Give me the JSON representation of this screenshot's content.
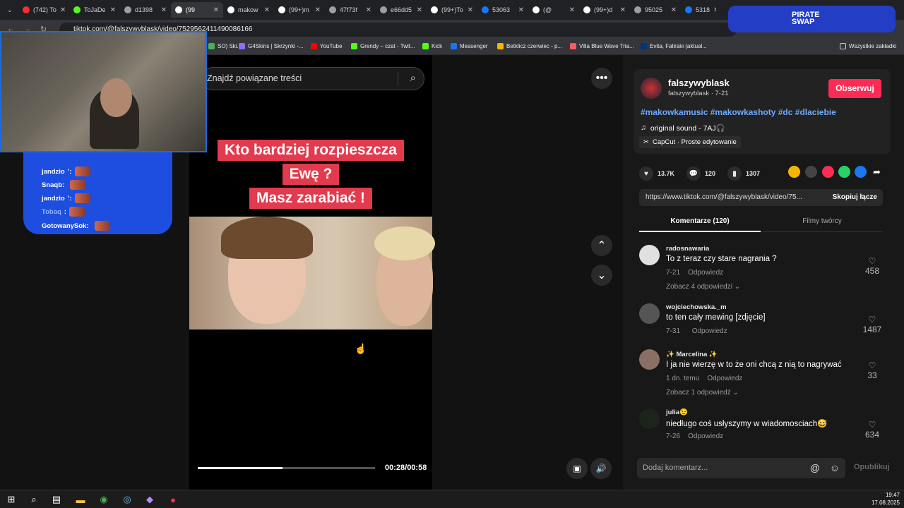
{
  "browser": {
    "tabs": [
      {
        "label": "(742) To",
        "color": "#ff2d2d"
      },
      {
        "label": "ToJaDe",
        "color": "#53fc18"
      },
      {
        "label": "d1398",
        "color": "#9aa0a6"
      },
      {
        "label": "(99",
        "color": "#ffffff",
        "active": true
      },
      {
        "label": "makow",
        "color": "#ffffff"
      },
      {
        "label": "(99+)m",
        "color": "#ffffff"
      },
      {
        "label": "47f73f",
        "color": "#9aa0a6"
      },
      {
        "label": "e66dd5",
        "color": "#9aa0a6"
      },
      {
        "label": "(99+)To",
        "color": "#ffffff"
      },
      {
        "label": "53063",
        "color": "#1877f2"
      },
      {
        "label": "(@",
        "color": "#ffffff"
      },
      {
        "label": "(99+)d",
        "color": "#ffffff"
      },
      {
        "label": "95025",
        "color": "#9aa0a6"
      },
      {
        "label": "5318",
        "color": "#1877f2"
      }
    ],
    "url": "tiktok.com/@falszywyblask/video/7529562411490086166",
    "bookmarks": [
      {
        "label": "SO) Ski...",
        "color": "#4caf50"
      },
      {
        "label": "G4Skins | Skrzynki -...",
        "color": "#8e6cff"
      },
      {
        "label": "YouTube",
        "color": "#ff0000"
      },
      {
        "label": "Grendy – czat - Twit...",
        "color": "#53fc18"
      },
      {
        "label": "Kick",
        "color": "#53fc18"
      },
      {
        "label": "Messenger",
        "color": "#1877f2"
      },
      {
        "label": "Betklicz czerwiec - p...",
        "color": "#f4b400"
      },
      {
        "label": "Villa Blue Wave Tria...",
        "color": "#ff5a5f"
      },
      {
        "label": "Evita, Faliraki (aktual...",
        "color": "#003580"
      }
    ],
    "all_bookmarks": "Wszystkie zakładki"
  },
  "overlay": {
    "pirate_swap": "PIRATE SWAP",
    "chat": [
      {
        "name": "jandzio",
        "suffix": "’:"
      },
      {
        "name": "Snaqb:",
        "suffix": ""
      },
      {
        "name": "jandzio",
        "suffix": "’:"
      },
      {
        "name": "Tobaq",
        "suffix": ":"
      },
      {
        "name": "GotowanySok:",
        "suffix": ""
      }
    ]
  },
  "video": {
    "search_placeholder": "Znajdź powiązane treści",
    "caption_lines": [
      "Kto bardziej rozpieszcza",
      "Ewę ?",
      "Masz zarabiać !"
    ],
    "time": "00:28/00:58",
    "progress": 0.48
  },
  "author": {
    "name": "falszywyblask",
    "handle": "falszywyblask · 7-21",
    "follow": "Obserwuj",
    "hashtags": "#makowkamusic #makowkashoty #dc #dlaciebie",
    "sound": "original sound - 7AJ🎧",
    "capcut": "CapCut · Proste edytowanie"
  },
  "stats": {
    "likes": "13.7K",
    "comments": "120",
    "saves": "1307"
  },
  "link": {
    "url": "https://www.tiktok.com/@falszywyblask/video/75...",
    "copy": "Skopiuj łącze"
  },
  "comment_tabs": {
    "comments": "Komentarze (120)",
    "creator": "Filmy twórcy"
  },
  "comments": [
    {
      "user": "radosnawaria",
      "text": "To z teraz czy stare nagrania ?",
      "date": "7-21",
      "reply": "Odpowiedz",
      "likes": "458",
      "more": "Zobacz 4 odpowiedzi"
    },
    {
      "user": "wojciechowska._m",
      "text": "to ten cały mewing [zdjęcie]",
      "date": "7-31",
      "reply": "Odpowiedz",
      "likes": "1487",
      "more": ""
    },
    {
      "user": "✨ Marcelina ✨",
      "text": "I ja nie wierzę w to że oni chcą z nią to nagrywać",
      "date": "1 dn. temu",
      "reply": "Odpowiedz",
      "likes": "33",
      "more": "Zobacz 1 odpowiedź"
    },
    {
      "user": "julia😉",
      "text": "niedługo coś usłyszymy w wiadomosciach😅",
      "date": "7-26",
      "reply": "Odpowiedz",
      "likes": "634",
      "more": ""
    }
  ],
  "add_comment": {
    "placeholder": "Dodaj komentarz...",
    "publish": "Opublikuj"
  },
  "taskbar": {
    "time": "19:47",
    "date": "17.08.2025"
  }
}
